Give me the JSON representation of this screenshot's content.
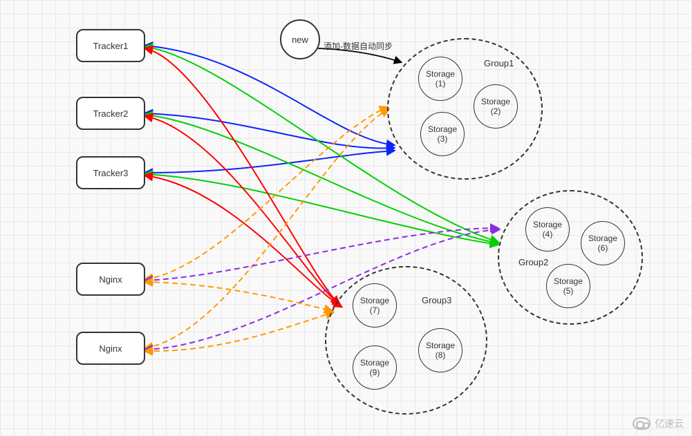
{
  "trackers": [
    {
      "label": "Tracker1"
    },
    {
      "label": "Tracker2"
    },
    {
      "label": "Tracker3"
    }
  ],
  "nginx_nodes": [
    {
      "label": "Nginx"
    },
    {
      "label": "Nginx"
    }
  ],
  "new_node": {
    "label": "new"
  },
  "annotation": {
    "new_group_arrow": "添加-数据自动同步"
  },
  "groups": [
    {
      "label": "Group1",
      "storages": [
        "Storage\n(1)",
        "Storage\n(2)",
        "Storage\n(3)"
      ]
    },
    {
      "label": "Group2",
      "storages": [
        "Storage\n(4)",
        "Storage\n(6)",
        "Storage\n(5)"
      ]
    },
    {
      "label": "Group3",
      "storages": [
        "Storage\n(7)",
        "Storage\n(8)",
        "Storage\n(9)"
      ]
    }
  ],
  "watermark": "亿速云",
  "edge_colors": {
    "tracker_to_group1": "#0b24fb",
    "tracker_to_group2": "#00d000",
    "tracker_to_group3": "#ff0000",
    "nginx_to_group1": "#ff9900",
    "nginx_to_group2": "#8a2be2",
    "nginx_to_group3": "#ff9900",
    "new_to_group1": "#000000"
  },
  "chart_data": {
    "type": "diagram",
    "title": "FastDFS-style Tracker / Storage topology with Nginx front-ends",
    "nodes": [
      {
        "id": "tracker1",
        "type": "tracker",
        "label": "Tracker1"
      },
      {
        "id": "tracker2",
        "type": "tracker",
        "label": "Tracker2"
      },
      {
        "id": "tracker3",
        "type": "tracker",
        "label": "Tracker3"
      },
      {
        "id": "nginx1",
        "type": "nginx",
        "label": "Nginx"
      },
      {
        "id": "nginx2",
        "type": "nginx",
        "label": "Nginx"
      },
      {
        "id": "new",
        "type": "new-storage",
        "label": "new"
      },
      {
        "id": "group1",
        "type": "group",
        "label": "Group1",
        "children": [
          "storage1",
          "storage2",
          "storage3"
        ]
      },
      {
        "id": "group2",
        "type": "group",
        "label": "Group2",
        "children": [
          "storage4",
          "storage5",
          "storage6"
        ]
      },
      {
        "id": "group3",
        "type": "group",
        "label": "Group3",
        "children": [
          "storage7",
          "storage8",
          "storage9"
        ]
      },
      {
        "id": "storage1",
        "type": "storage",
        "label": "Storage (1)",
        "group": "group1"
      },
      {
        "id": "storage2",
        "type": "storage",
        "label": "Storage (2)",
        "group": "group1"
      },
      {
        "id": "storage3",
        "type": "storage",
        "label": "Storage (3)",
        "group": "group1"
      },
      {
        "id": "storage4",
        "type": "storage",
        "label": "Storage (4)",
        "group": "group2"
      },
      {
        "id": "storage5",
        "type": "storage",
        "label": "Storage (5)",
        "group": "group2"
      },
      {
        "id": "storage6",
        "type": "storage",
        "label": "Storage (6)",
        "group": "group2"
      },
      {
        "id": "storage7",
        "type": "storage",
        "label": "Storage (7)",
        "group": "group3"
      },
      {
        "id": "storage8",
        "type": "storage",
        "label": "Storage (8)",
        "group": "group3"
      },
      {
        "id": "storage9",
        "type": "storage",
        "label": "Storage (9)",
        "group": "group3"
      }
    ],
    "edges": [
      {
        "from": "tracker1",
        "to": "group1",
        "color": "#0b24fb",
        "style": "solid"
      },
      {
        "from": "tracker2",
        "to": "group1",
        "color": "#0b24fb",
        "style": "solid"
      },
      {
        "from": "tracker3",
        "to": "group1",
        "color": "#0b24fb",
        "style": "solid"
      },
      {
        "from": "tracker1",
        "to": "group2",
        "color": "#00d000",
        "style": "solid"
      },
      {
        "from": "tracker2",
        "to": "group2",
        "color": "#00d000",
        "style": "solid"
      },
      {
        "from": "tracker3",
        "to": "group2",
        "color": "#00d000",
        "style": "solid"
      },
      {
        "from": "tracker1",
        "to": "group3",
        "color": "#ff0000",
        "style": "solid"
      },
      {
        "from": "tracker2",
        "to": "group3",
        "color": "#ff0000",
        "style": "solid"
      },
      {
        "from": "tracker3",
        "to": "group3",
        "color": "#ff0000",
        "style": "solid"
      },
      {
        "from": "nginx1",
        "to": "group1",
        "color": "#ff9900",
        "style": "dashed"
      },
      {
        "from": "nginx2",
        "to": "group1",
        "color": "#ff9900",
        "style": "dashed"
      },
      {
        "from": "nginx1",
        "to": "group2",
        "color": "#8a2be2",
        "style": "dashed"
      },
      {
        "from": "nginx2",
        "to": "group2",
        "color": "#8a2be2",
        "style": "dashed"
      },
      {
        "from": "nginx1",
        "to": "group3",
        "color": "#ff9900",
        "style": "dashed"
      },
      {
        "from": "nginx2",
        "to": "group3",
        "color": "#ff9900",
        "style": "dashed"
      },
      {
        "from": "new",
        "to": "group1",
        "color": "#000000",
        "style": "solid",
        "annotation": "添加-数据自动同步"
      }
    ]
  }
}
